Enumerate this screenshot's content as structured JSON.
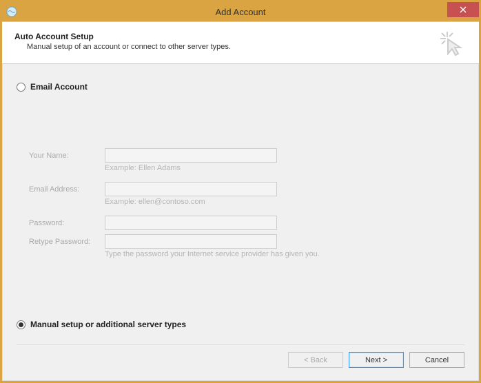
{
  "titlebar": {
    "title": "Add Account"
  },
  "header": {
    "title": "Auto Account Setup",
    "subtitle": "Manual setup of an account or connect to other server types."
  },
  "options": {
    "email": {
      "label": "Email Account",
      "selected": false
    },
    "manual": {
      "label": "Manual setup or additional server types",
      "selected": true
    }
  },
  "fields": {
    "name": {
      "label": "Your Name:",
      "value": "",
      "hint": "Example: Ellen Adams"
    },
    "email": {
      "label": "Email Address:",
      "value": "",
      "hint": "Example: ellen@contoso.com"
    },
    "password": {
      "label": "Password:",
      "value": ""
    },
    "retype": {
      "label": "Retype Password:",
      "value": "",
      "hint": "Type the password your Internet service provider has given you."
    }
  },
  "footer": {
    "back": "< Back",
    "next": "Next >",
    "cancel": "Cancel"
  }
}
